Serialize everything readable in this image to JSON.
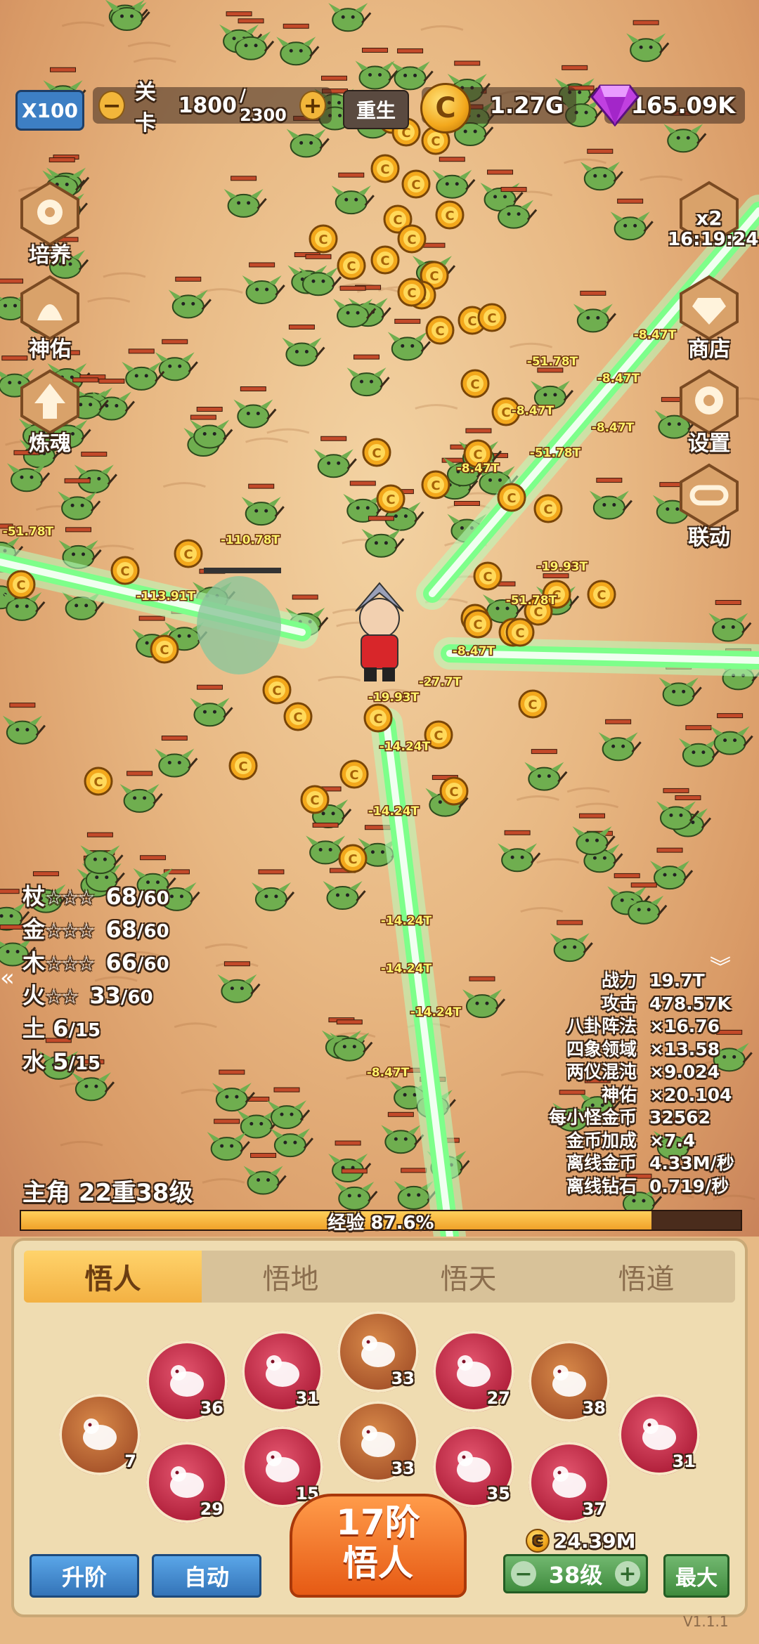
{
  "top_bar": {
    "multiplier": "X100",
    "stage_label": "关卡",
    "stage_current": "1800",
    "stage_total": "/ 2300",
    "reset_label": "重生",
    "gold": "1.27G",
    "gems": "165.09K"
  },
  "left_menu": [
    {
      "label": "培养",
      "icon": "cultivate-icon"
    },
    {
      "label": "神佑",
      "icon": "blessing-icon"
    },
    {
      "label": "炼魂",
      "icon": "soul-refine-icon"
    }
  ],
  "right_menu": {
    "boost_badge": "x2",
    "timer": "16:19:24",
    "items": [
      {
        "label": "商店",
        "icon": "diamond-icon"
      },
      {
        "label": "设置",
        "icon": "gear-icon"
      },
      {
        "label": "联动",
        "icon": "link-icon"
      }
    ]
  },
  "damage_numbers": [
    "-51.78T",
    "-8.47T",
    "-51.78T",
    "-8.47T",
    "-8.47T",
    "-51.78T",
    "-8.47T",
    "-110.78T",
    "-113.91T",
    "-8.47T",
    "-19.93T",
    "-8.47T",
    "-27.7T",
    "-19.93T",
    "-14.24T",
    "-14.24T",
    "-14.24T",
    "-14.24T",
    "-14.24T",
    "-8.47T",
    "-51.78T"
  ],
  "elements": [
    {
      "name": "杖",
      "stars": "☆☆☆",
      "value": "68",
      "max": "/60"
    },
    {
      "name": "金",
      "stars": "☆☆☆",
      "value": "68",
      "max": "/60"
    },
    {
      "name": "木",
      "stars": "☆☆☆",
      "value": "66",
      "max": "/60"
    },
    {
      "name": "火",
      "stars": "☆☆",
      "value": "33",
      "max": "/60"
    },
    {
      "name": "土",
      "stars": "",
      "value": "6",
      "max": "/15"
    },
    {
      "name": "水",
      "stars": "",
      "value": "5",
      "max": "/15"
    }
  ],
  "stats": [
    {
      "label": "战力",
      "value": "19.7T"
    },
    {
      "label": "攻击",
      "value": "478.57K"
    },
    {
      "label": "八卦阵法",
      "value": "×16.76"
    },
    {
      "label": "四象领域",
      "value": "×13.58"
    },
    {
      "label": "两仪混沌",
      "value": "×9.024"
    },
    {
      "label": "神佑",
      "value": "×20.104"
    },
    {
      "label": "每小怪金币",
      "value": "32562"
    },
    {
      "label": "金币加成",
      "value": "×7.4"
    },
    {
      "label": "离线金币",
      "value": "4.33M/秒"
    },
    {
      "label": "离线钻石",
      "value": "0.719/秒"
    }
  ],
  "hero": {
    "level_text": "主角 22重38级",
    "exp_text": "经验 87.6%",
    "exp_fraction": 0.876
  },
  "tabs": [
    "悟人",
    "悟地",
    "悟天",
    "悟道"
  ],
  "zodiacs": [
    {
      "name": "rat",
      "level": "7",
      "style": "brown"
    },
    {
      "name": "ox",
      "level": "36",
      "style": "red"
    },
    {
      "name": "tiger",
      "level": "31",
      "style": "red"
    },
    {
      "name": "rabbit",
      "level": "29",
      "style": "red"
    },
    {
      "name": "dragon-head",
      "level": "33",
      "style": "brown"
    },
    {
      "name": "monkey",
      "level": "15",
      "style": "red"
    },
    {
      "name": "rooster",
      "level": "33",
      "style": "brown"
    },
    {
      "name": "dragon",
      "level": "27",
      "style": "red"
    },
    {
      "name": "dog",
      "level": "35",
      "style": "red"
    },
    {
      "name": "snake",
      "level": "38",
      "style": "brown"
    },
    {
      "name": "pig",
      "level": "37",
      "style": "red"
    },
    {
      "name": "horse",
      "level": "31",
      "style": "red"
    }
  ],
  "bottom": {
    "upgrade_label": "升阶",
    "auto_label": "自动",
    "main_line1": "17阶",
    "main_line2": "悟人",
    "cost": "24.39M",
    "level": "38级",
    "max_label": "最大",
    "version": "V1.1.1"
  },
  "colors": {
    "beam": "#7dff8a",
    "enemy": "#6fae4f",
    "coin": "#f3a81c",
    "tab_active": "#f3b143"
  }
}
